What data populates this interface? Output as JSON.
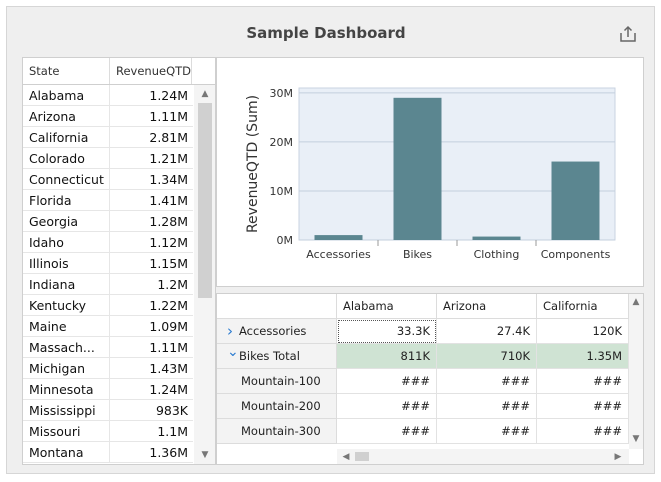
{
  "dashboard": {
    "title": "Sample Dashboard",
    "export_icon": "export-icon"
  },
  "grid": {
    "columns": [
      "State",
      "RevenueQTD..."
    ],
    "rows": [
      {
        "state": "Alabama",
        "revenue": "1.24M"
      },
      {
        "state": "Arizona",
        "revenue": "1.11M"
      },
      {
        "state": "California",
        "revenue": "2.81M"
      },
      {
        "state": "Colorado",
        "revenue": "1.21M"
      },
      {
        "state": "Connecticut",
        "revenue": "1.34M"
      },
      {
        "state": "Florida",
        "revenue": "1.41M"
      },
      {
        "state": "Georgia",
        "revenue": "1.28M"
      },
      {
        "state": "Idaho",
        "revenue": "1.12M"
      },
      {
        "state": "Illinois",
        "revenue": "1.15M"
      },
      {
        "state": "Indiana",
        "revenue": "1.2M"
      },
      {
        "state": "Kentucky",
        "revenue": "1.22M"
      },
      {
        "state": "Maine",
        "revenue": "1.09M"
      },
      {
        "state": "Massach...",
        "revenue": "1.11M"
      },
      {
        "state": "Michigan",
        "revenue": "1.43M"
      },
      {
        "state": "Minnesota",
        "revenue": "1.24M"
      },
      {
        "state": "Mississippi",
        "revenue": "983K"
      },
      {
        "state": "Missouri",
        "revenue": "1.1M"
      },
      {
        "state": "Montana",
        "revenue": "1.36M"
      }
    ]
  },
  "chart_data": {
    "type": "bar",
    "categories": [
      "Accessories",
      "Bikes",
      "Clothing",
      "Components"
    ],
    "values": [
      1000000,
      29000000,
      700000,
      16000000
    ],
    "title": "",
    "xlabel": "",
    "ylabel": "RevenueQTD (Sum)",
    "ylim": [
      0,
      31000000
    ],
    "yticks": [
      0,
      10000000,
      20000000,
      30000000
    ],
    "ytick_labels": [
      "0M",
      "10M",
      "20M",
      "30M"
    ],
    "grid": true,
    "bar_color": "#5b8690",
    "plot_background": "#e9eff7"
  },
  "pivot": {
    "columns": [
      "Alabama",
      "Arizona",
      "California"
    ],
    "rows": [
      {
        "label": "Accessories",
        "expander": "chevron-right-icon",
        "values": [
          "33.3K",
          "27.4K",
          "120K"
        ],
        "total": false
      },
      {
        "label": "Bikes Total",
        "expander": "chevron-down-icon",
        "values": [
          "811K",
          "710K",
          "1.35M"
        ],
        "total": true
      },
      {
        "label": "Mountain-100",
        "expander": "",
        "values": [
          "###",
          "###",
          "###"
        ],
        "total": false
      },
      {
        "label": "Mountain-200",
        "expander": "",
        "values": [
          "###",
          "###",
          "###"
        ],
        "total": false
      },
      {
        "label": "Mountain-300",
        "expander": "",
        "values": [
          "###",
          "###",
          "###"
        ],
        "total": false
      }
    ]
  }
}
